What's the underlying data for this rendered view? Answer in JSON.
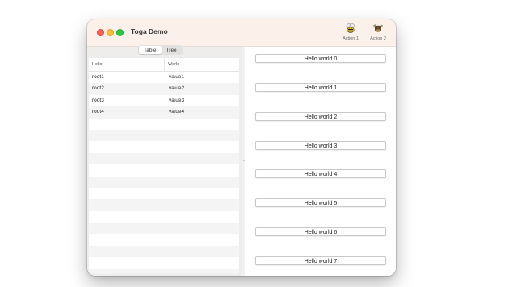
{
  "window": {
    "title": "Toga Demo"
  },
  "toolbar": {
    "action1": {
      "label": "Action 1",
      "icon": "bee-icon"
    },
    "action2": {
      "label": "Action 2",
      "icon": "brutus-icon"
    }
  },
  "tabs": [
    {
      "label": "Table",
      "selected": true
    },
    {
      "label": "Tree",
      "selected": false
    }
  ],
  "table": {
    "columns": [
      "Hello",
      "World"
    ],
    "rows": [
      [
        "root1",
        "value1"
      ],
      [
        "root2",
        "value2"
      ],
      [
        "root3",
        "value3"
      ],
      [
        "root4",
        "value4"
      ]
    ]
  },
  "buttons": [
    "Hello world 0",
    "Hello world 1",
    "Hello world 2",
    "Hello world 3",
    "Hello world 4",
    "Hello world 5",
    "Hello world 6",
    "Hello world 7"
  ],
  "colors": {
    "titlebar": "#fcf1ea",
    "close": "#ff5f57",
    "minimize": "#febc2e",
    "maximize": "#28c840"
  }
}
